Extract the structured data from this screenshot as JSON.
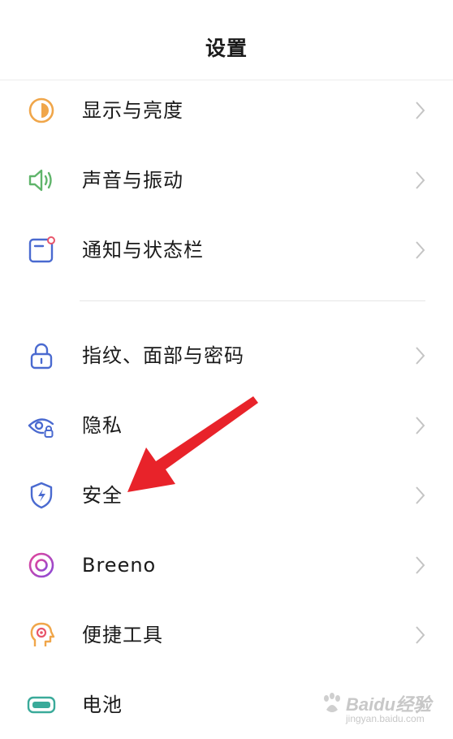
{
  "header": {
    "title": "设置"
  },
  "groups": [
    {
      "items": [
        {
          "label": "显示与亮度",
          "icon": "brightness-icon"
        },
        {
          "label": "声音与振动",
          "icon": "speaker-icon"
        },
        {
          "label": "通知与状态栏",
          "icon": "notification-icon"
        }
      ]
    },
    {
      "items": [
        {
          "label": "指纹、面部与密码",
          "icon": "lock-icon"
        },
        {
          "label": "隐私",
          "icon": "privacy-eye-icon"
        },
        {
          "label": "安全",
          "icon": "shield-icon"
        },
        {
          "label": "Breeno",
          "icon": "breeno-icon"
        },
        {
          "label": "便捷工具",
          "icon": "shortcut-tools-icon"
        },
        {
          "label": "电池",
          "icon": "battery-icon"
        }
      ]
    }
  ],
  "watermark": {
    "main": "Baidu经验",
    "sub": "jingyan.baidu.com"
  },
  "colors": {
    "orange": "#f0a64a",
    "green": "#5fb46a",
    "blue": "#4a6ad0",
    "teal": "#3aaa9a",
    "pink": "#d0459a",
    "arrow_red": "#e8232a"
  }
}
